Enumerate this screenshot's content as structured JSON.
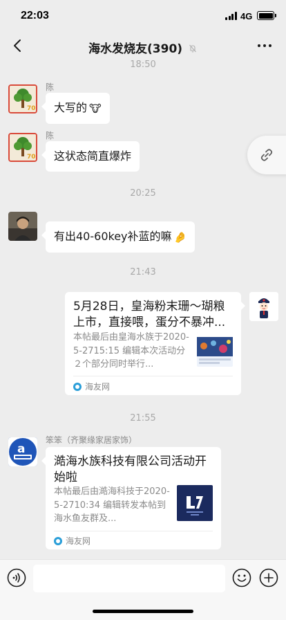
{
  "status_bar": {
    "time": "22:03",
    "network": "4G"
  },
  "nav": {
    "title": "海水发烧友(390)"
  },
  "messages": {
    "t1": "18:50",
    "m1": {
      "sender": "陈",
      "text": "大写的"
    },
    "m2": {
      "sender": "陈",
      "text": "这状态简直爆炸"
    },
    "t2": "20:25",
    "m3": {
      "text": "有出40-60key补蓝的嘛"
    },
    "t3": "21:43",
    "card1": {
      "title": "5月28日，皇海粉末珊～瑚粮上市，直接喂，蛋分不暴冲...",
      "desc": "本帖最后由皇海水族于2020-5-2715:15 编辑本次活动分２个部分同时举行...",
      "source": "海友网"
    },
    "t4": "21:55",
    "card2": {
      "sender": "笨笨（齐聚缘家居家饰）",
      "title": "澔海水族科技有限公司活动开始啦",
      "desc": "本帖最后由澔海科技于2020-5-2710:34 编辑转发本帖到海水鱼友群及...",
      "source": "海友网"
    }
  },
  "icons": {
    "back": "chevron-left-icon",
    "more": "more-dots-icon",
    "mute": "mute-bell-icon",
    "link": "link-icon",
    "voice": "voice-icon",
    "emoji": "emoji-icon",
    "plus": "plus-icon"
  },
  "colors": {
    "background": "#ededed",
    "bubble": "#ffffff",
    "source_icon": "#2a9ed8"
  }
}
